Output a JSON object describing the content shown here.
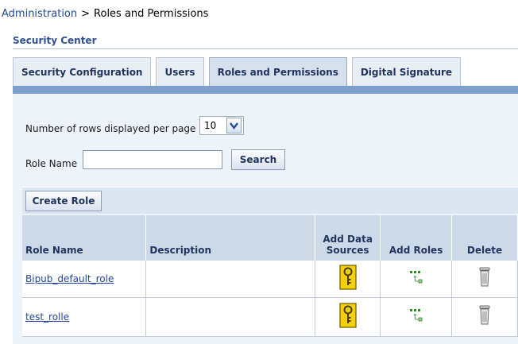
{
  "breadcrumb": {
    "parent": "Administration",
    "separator": ">",
    "current": "Roles and Permissions"
  },
  "section": {
    "title": "Security Center"
  },
  "tabs": [
    {
      "label": "Security Configuration",
      "active": false
    },
    {
      "label": "Users",
      "active": false
    },
    {
      "label": "Roles and Permissions",
      "active": true
    },
    {
      "label": "Digital Signature",
      "active": false
    }
  ],
  "filter": {
    "rows_label": "Number of rows displayed per page",
    "rows_value": "10",
    "role_name_label": "Role Name",
    "role_name_value": "",
    "search_label": "Search"
  },
  "toolbar": {
    "create_label": "Create Role"
  },
  "table": {
    "headers": {
      "role_name": "Role Name",
      "description": "Description",
      "add_data_sources_line1": "Add Data",
      "add_data_sources_line2": "Sources",
      "add_roles": "Add Roles",
      "delete": "Delete"
    },
    "rows": [
      {
        "role_name": "Bipub_default_role",
        "description": ""
      },
      {
        "role_name": "test_rolle",
        "description": ""
      }
    ]
  },
  "icons": {
    "add_data_sources": "key-icon",
    "add_roles": "hierarchy-icon",
    "delete": "trash-icon",
    "rows_dropdown": "chevron-down-icon"
  },
  "colors": {
    "link": "#23489e",
    "tab_bar": "#7d9fcb",
    "panel": "#edf3f9",
    "header": "#ccd9e9",
    "key_icon": "#f5d000"
  }
}
